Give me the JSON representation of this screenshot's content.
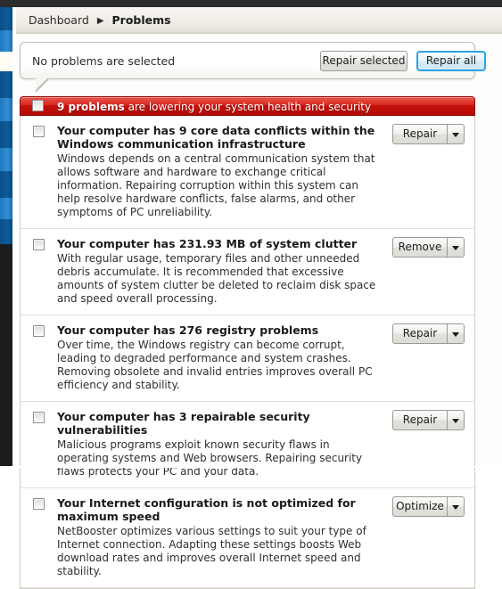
{
  "window": {
    "titlebar_color": "#2b2d2e",
    "sidebar_accent_color": "#0d5c9c"
  },
  "breadcrumb": {
    "root_label": "Dashboard",
    "separator": "▶",
    "current_label": "Problems"
  },
  "toolbar": {
    "selection_status": "No problems are selected",
    "repair_selected_label": "Repair selected",
    "repair_all_label": "Repair all",
    "repair_all_accent_color": "#2ca3e0"
  },
  "banner": {
    "count_text": "9 problems",
    "rest_text": " are lowering your system health and security",
    "background_color": "#c5100a",
    "checkbox_checked": false
  },
  "problems": [
    {
      "checked": false,
      "title": "Your computer has 9 core data conflicts within the Windows communication infrastructure",
      "description": "Windows depends on a central communication system that allows software and hardware to exchange critical information. Repairing corruption within this system can help resolve hardware conflicts, false alarms, and other symptoms of PC unreliability.",
      "action_label": "Repair",
      "dropdown_icon": "chevron-down-icon"
    },
    {
      "checked": false,
      "title": "Your computer has 231.93 MB of system clutter",
      "description": "With regular usage, temporary files and other unneeded debris accumulate. It is recommended that excessive amounts of system clutter be deleted to reclaim disk space and speed overall processing.",
      "action_label": "Remove",
      "dropdown_icon": "chevron-down-icon"
    },
    {
      "checked": false,
      "title": "Your computer has 276 registry problems",
      "description": "Over time, the Windows registry can become corrupt, leading to degraded performance and system crashes. Removing obsolete and invalid entries improves overall PC efficiency and stability.",
      "action_label": "Repair",
      "dropdown_icon": "chevron-down-icon"
    },
    {
      "checked": false,
      "title": "Your computer has 3 repairable security vulnerabilities",
      "description": "Malicious programs exploit known security flaws in operating systems and Web browsers. Repairing security flaws protects your PC and your data.",
      "action_label": "Repair",
      "dropdown_icon": "chevron-down-icon"
    },
    {
      "checked": false,
      "title": "Your Internet configuration is not optimized for maximum speed",
      "description": "NetBooster optimizes various settings to suit your type of Internet connection. Adapting these settings boosts Web download rates and improves overall Internet speed and stability.",
      "action_label": "Optimize",
      "dropdown_icon": "chevron-down-icon"
    }
  ]
}
